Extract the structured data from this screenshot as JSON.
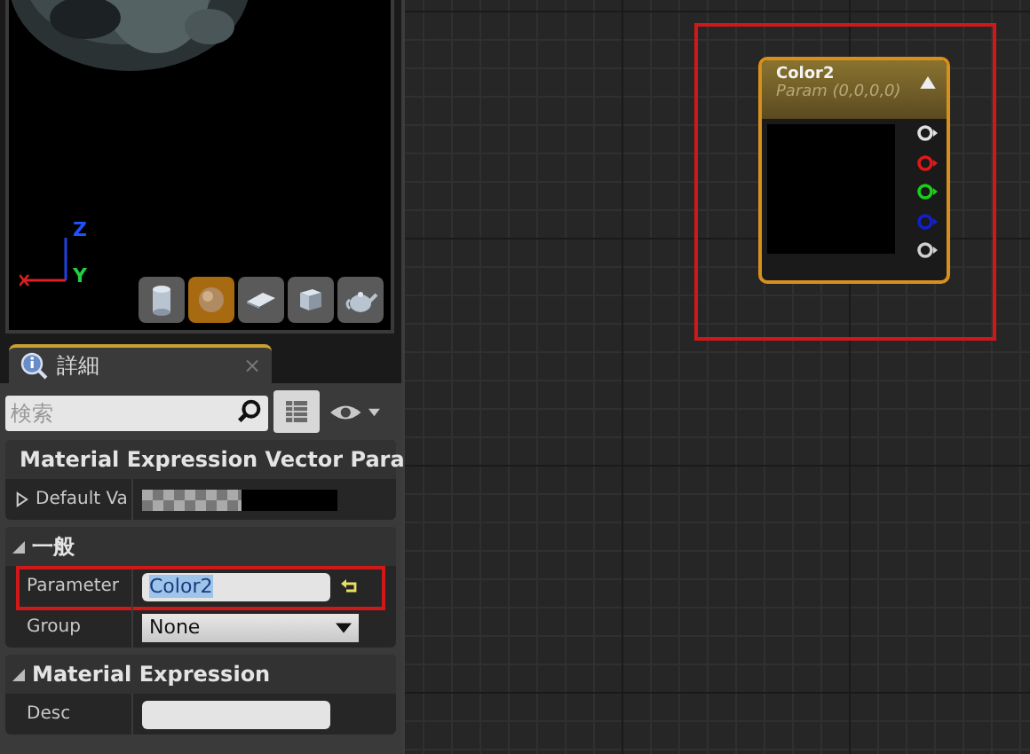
{
  "viewport": {
    "axis_labels": [
      "Z",
      "Y"
    ],
    "preview_buttons": [
      {
        "kind": "cylinder",
        "selected": false
      },
      {
        "kind": "sphere",
        "selected": true
      },
      {
        "kind": "plane",
        "selected": false
      },
      {
        "kind": "cube",
        "selected": false
      },
      {
        "kind": "teapot",
        "selected": false
      }
    ]
  },
  "details_tab": {
    "title": "詳細",
    "close": "×"
  },
  "search": {
    "placeholder": "検索"
  },
  "sections": [
    {
      "title": "Material Expression Vector Para",
      "rows": [
        {
          "kind": "color",
          "label": "Default Va",
          "expanded": false
        }
      ]
    },
    {
      "title": "一般",
      "rows": [
        {
          "kind": "text",
          "label": "Parameter",
          "value": "Color2",
          "highlighted": true,
          "text_selected": true,
          "resettable": true
        },
        {
          "kind": "dropdown",
          "label": "Group",
          "value": "None"
        }
      ]
    },
    {
      "title": "Material Expression",
      "rows": [
        {
          "kind": "text",
          "label": "Desc"
        }
      ]
    }
  ],
  "node": {
    "title": "Color2",
    "subtitle": "Param (0,0,0,0)",
    "highlighted": true,
    "pins": [
      {
        "color": "#e0e0e0"
      },
      {
        "color": "#e01818"
      },
      {
        "color": "#18d018"
      },
      {
        "color": "#1020d0"
      },
      {
        "color": "#d0d0d0"
      }
    ]
  }
}
